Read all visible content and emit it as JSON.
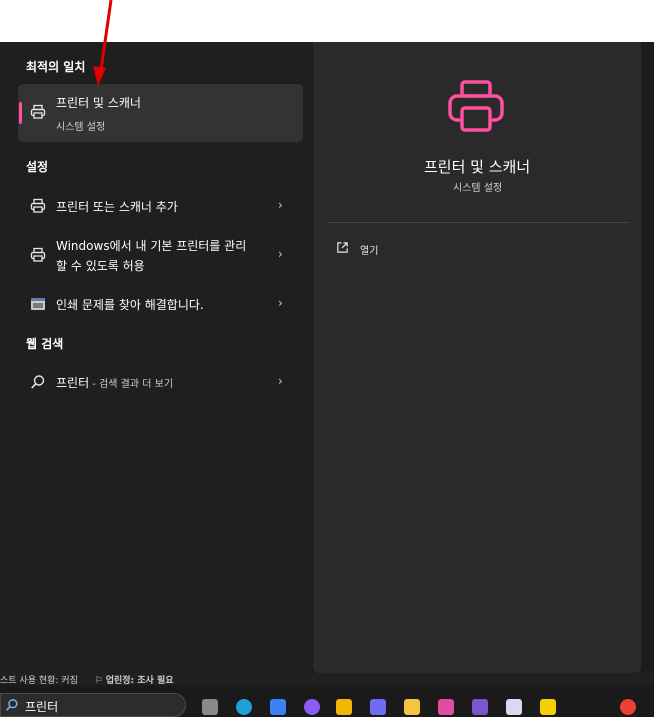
{
  "best_match": {
    "heading": "최적의 일치",
    "item_title": "프린터 및 스캐너",
    "item_sub": "시스템 설정"
  },
  "settings": {
    "heading": "설정",
    "items": [
      {
        "label": "프린터 또는 스캐너 추가"
      },
      {
        "label_line1": "Windows에서 내 기본 프린터를 관리",
        "label_line2": "할 수 있도록 허용"
      },
      {
        "label": "인쇄 문제를 찾아 해결합니다."
      }
    ]
  },
  "web": {
    "heading": "웹 검색",
    "query": "프린터",
    "suffix": " - 검색 결과 더 보기"
  },
  "detail": {
    "title": "프린터 및 스캐너",
    "subtitle": "시스템 설정",
    "open_label": "열기"
  },
  "taskbar": {
    "search_value": "프린터",
    "status_left": "스트 사용 현황: 커짐",
    "status_right": "업린정: 조사 필요"
  },
  "colors": {
    "accent": "#ff4fa0",
    "panel_left": "#1f1f1f",
    "panel_right": "#2a2a2a",
    "arrow": "#e00000"
  }
}
